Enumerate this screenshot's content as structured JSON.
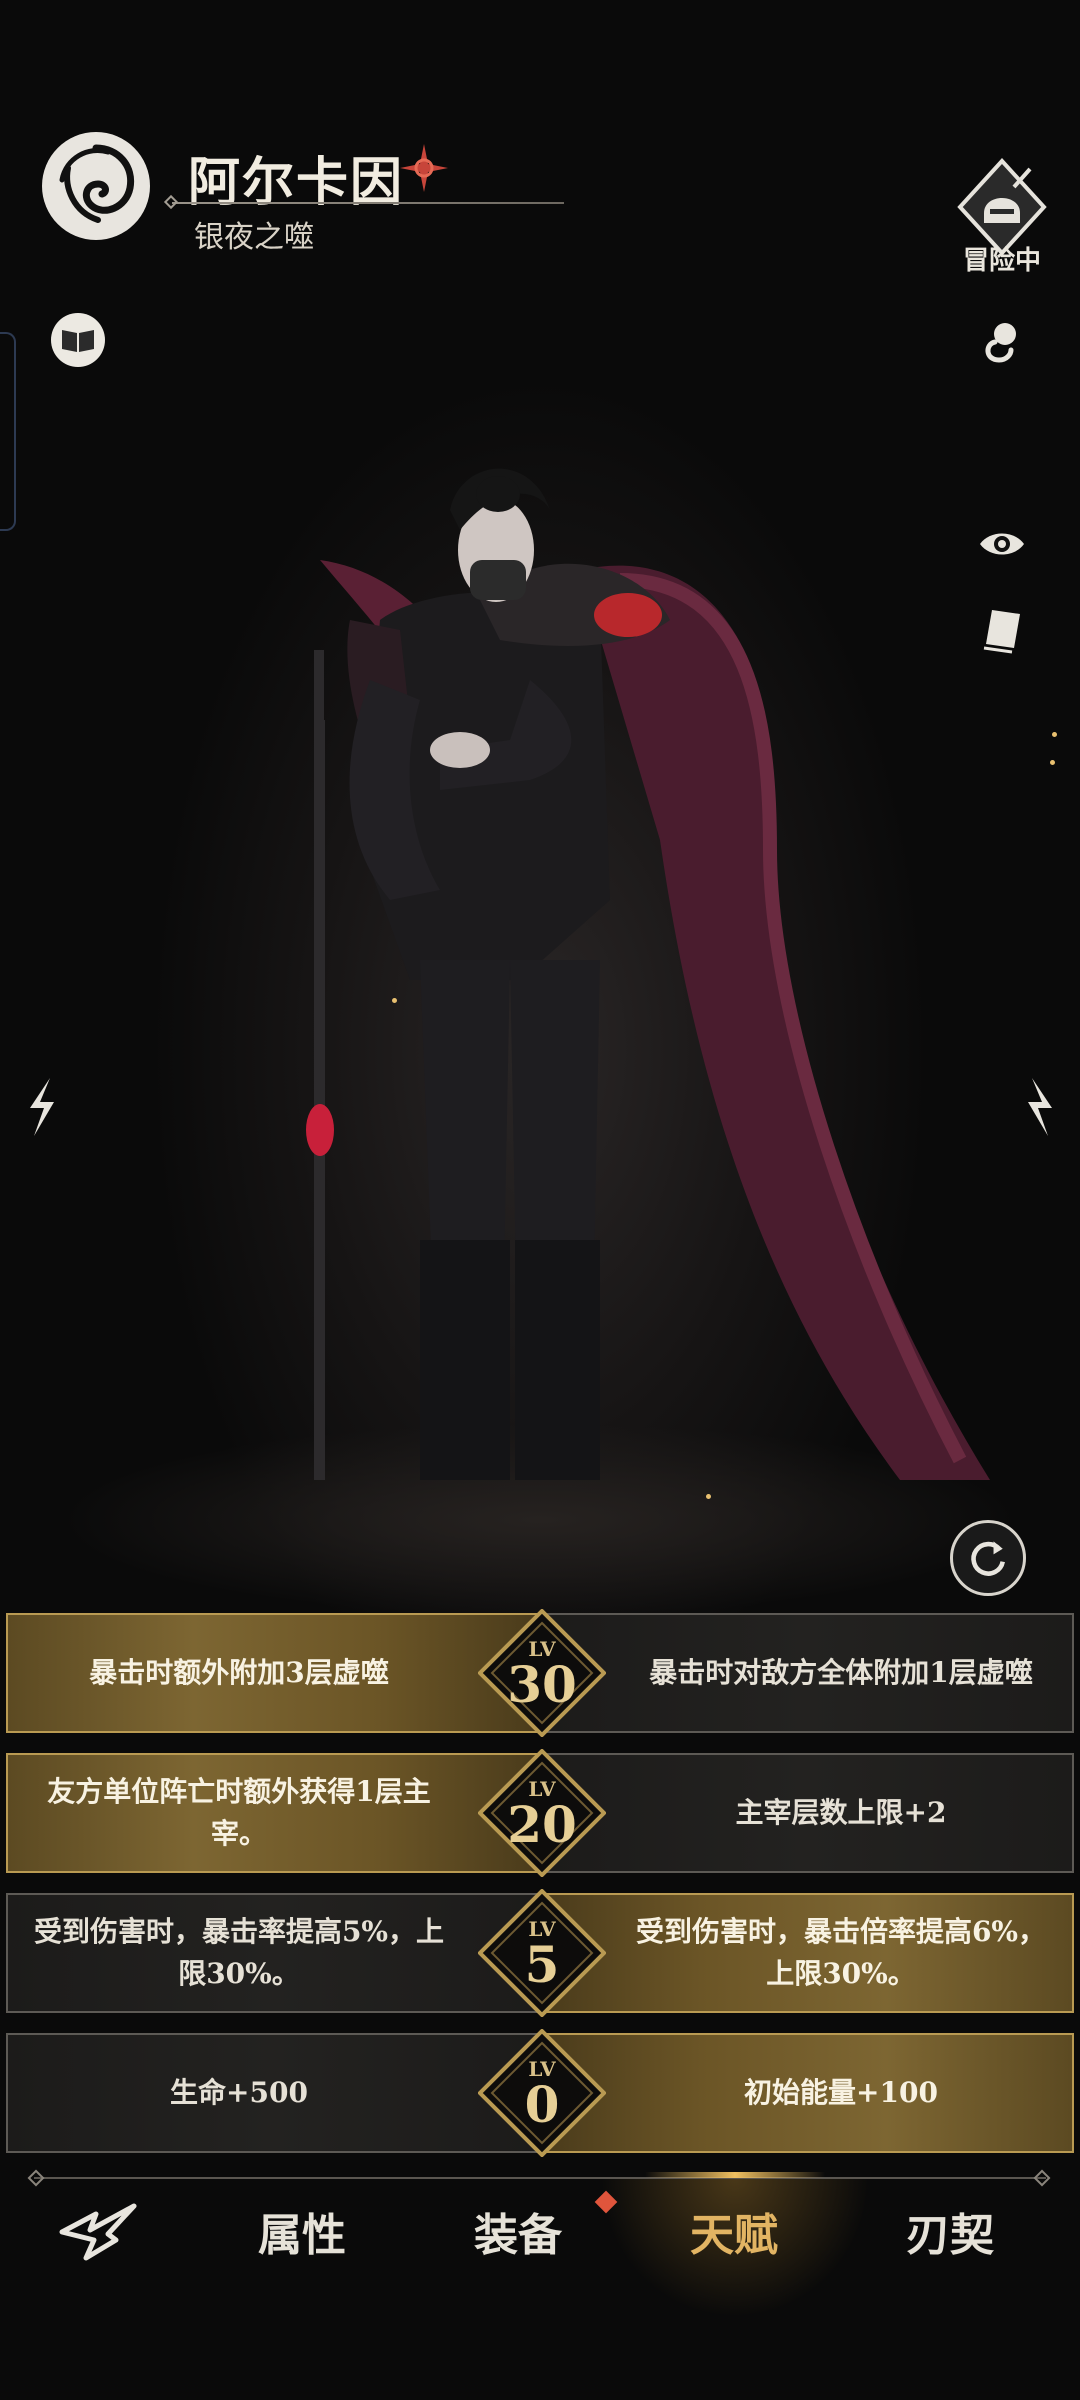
{
  "character": {
    "name": "阿尔卡因",
    "title": "银夜之噬",
    "status": "冒险中"
  },
  "icons": {
    "emblem": "swirl-emblem-icon",
    "book": "book-icon",
    "eye": "eye-icon",
    "card": "card-icon",
    "pin": "pin-icon",
    "rotate": "rotate-icon"
  },
  "talents": [
    {
      "lv_label": "LV",
      "level": "30",
      "left": "暴击时额外附加3层虚噬",
      "right": "暴击时对敌方全体附加1层虚噬",
      "active": "left"
    },
    {
      "lv_label": "LV",
      "level": "20",
      "left": "友方单位阵亡时额外获得1层主宰。",
      "right": "主宰层数上限+2",
      "active": "left"
    },
    {
      "lv_label": "LV",
      "level": "5",
      "left": "受到伤害时，暴击率提高5%，上限30%。",
      "right": "受到伤害时，暴击倍率提高6%，上限30%。",
      "active": "right"
    },
    {
      "lv_label": "LV",
      "level": "0",
      "left": "生命+500",
      "right": "初始能量+100",
      "active": "right"
    }
  ],
  "nav": {
    "tabs": [
      "属性",
      "装备",
      "天赋",
      "刃契"
    ],
    "active": "天赋"
  },
  "colors": {
    "gold": "#b99a52",
    "active_tab": "#e2b463",
    "badge_dot": "#e0553c"
  }
}
